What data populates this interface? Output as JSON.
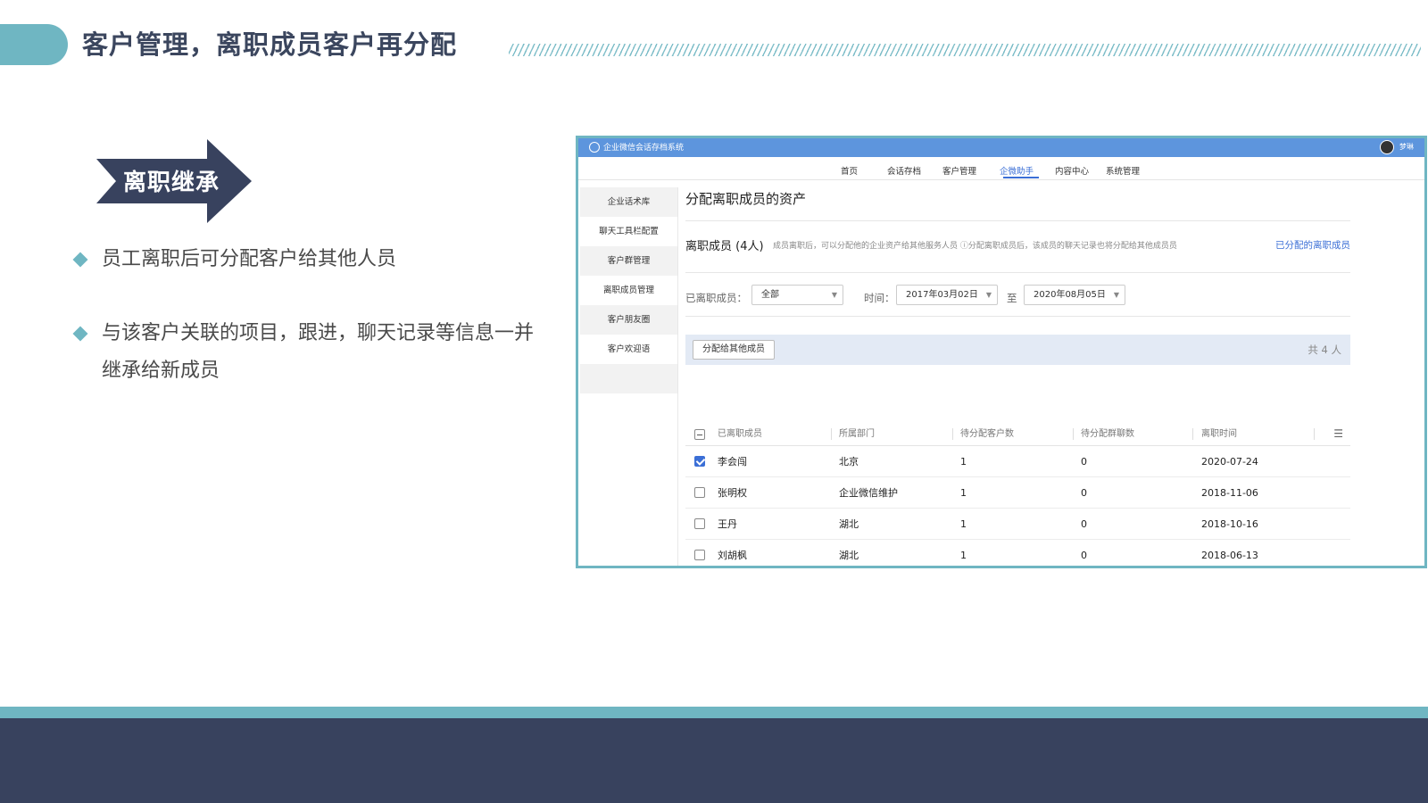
{
  "slide": {
    "title": "客户管理，离职成员客户再分配",
    "badge": "离职继承",
    "bullets": [
      "员工离职后可分配客户给其他人员",
      "与该客户关联的项目，跟进，聊天记录等信息一并继承给新成员"
    ],
    "colors": {
      "accent": "#6fb6c2",
      "navy": "#38425e",
      "link": "#3b6fd6"
    }
  },
  "app": {
    "title": "企业微信会话存档系统",
    "user": "梦琳",
    "nav": [
      "首页",
      "会话存档",
      "客户管理",
      "企微助手",
      "内容中心",
      "系统管理"
    ],
    "nav_active": "企微助手",
    "sidebar": [
      "企业话术库",
      "聊天工具栏配置",
      "客户群管理",
      "离职成员管理",
      "客户朋友圈",
      "客户欢迎语"
    ],
    "page_title": "分配离职成员的资产",
    "section": {
      "title": "离职成员 (4人)",
      "desc": "成员离职后，可以分配他的企业资产给其他服务人员 ⓘ分配离职成员后，该成员的聊天记录也将分配给其他成员员",
      "link": "已分配的离职成员"
    },
    "filters": {
      "member_label": "已离职成员：",
      "member_value": "全部",
      "time_label": "时间：",
      "start_date": "2017年03月02日",
      "to_label": "至",
      "end_date": "2020年08月05日"
    },
    "action_button": "分配给其他成员",
    "total": "共 4 人",
    "table": {
      "headers": [
        "已离职成员",
        "所属部门",
        "待分配客户数",
        "待分配群聊数",
        "离职时间"
      ],
      "rows": [
        {
          "name": "李会闯",
          "dept": "北京",
          "customers": "1",
          "groups": "0",
          "date": "2020-07-24",
          "checked": true
        },
        {
          "name": "张明权",
          "dept": "企业微信维护",
          "customers": "1",
          "groups": "0",
          "date": "2018-11-06",
          "checked": false
        },
        {
          "name": "王丹",
          "dept": "湖北",
          "customers": "1",
          "groups": "0",
          "date": "2018-10-16",
          "checked": false
        },
        {
          "name": "刘胡枫",
          "dept": "湖北",
          "customers": "1",
          "groups": "0",
          "date": "2018-06-13",
          "checked": false
        }
      ]
    }
  }
}
